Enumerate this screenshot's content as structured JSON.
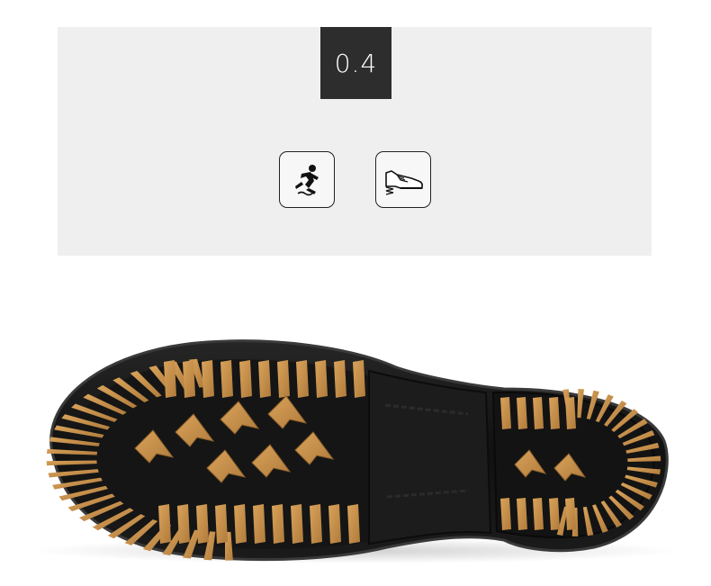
{
  "info_panel": {
    "value_label": "0.4",
    "icons": [
      {
        "name": "anti-slip-icon"
      },
      {
        "name": "shoe-spring-icon"
      }
    ]
  },
  "product_photo": {
    "colors": {
      "outsole": "#141414",
      "tread_lugs": "#c8944e",
      "tread_lug_shade": "#a8753a",
      "heel_grip_panel": "#1e1e1e"
    }
  }
}
